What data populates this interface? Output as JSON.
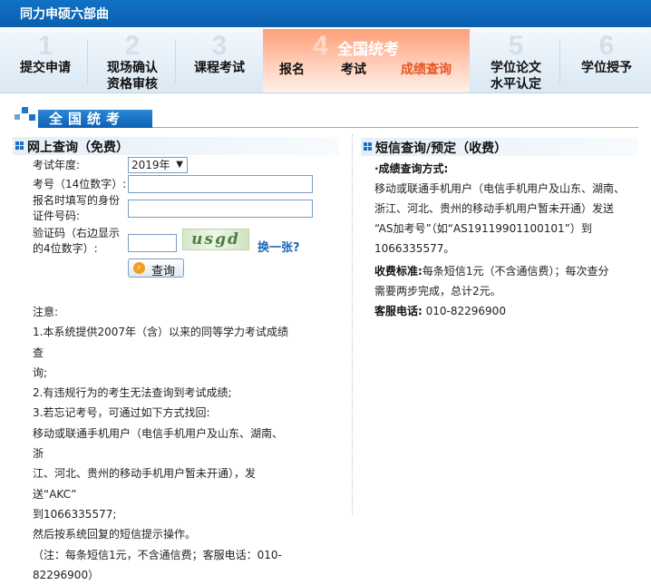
{
  "header": {
    "title": "同力申硕六部曲"
  },
  "steps": [
    {
      "num": "1",
      "label": "提交申请"
    },
    {
      "num": "2",
      "label": "现场确认\n资格审核"
    },
    {
      "num": "3",
      "label": "课程考试"
    },
    {
      "num": "4",
      "label": "全国统考",
      "subs": [
        "报名",
        "考试",
        "成绩查询"
      ],
      "active_sub": "成绩查询"
    },
    {
      "num": "5",
      "label": "学位论文\n水平认定"
    },
    {
      "num": "6",
      "label": "学位授予"
    }
  ],
  "section": {
    "title": "全国统考"
  },
  "online": {
    "heading": "网上查询（免费）",
    "year_label": "考试年度:",
    "year_value": "2019年",
    "exam_no_label": "考号（14位数字）:",
    "id_label_1": "报名时填写的身份",
    "id_label_2": "证件号码:",
    "captcha_label_1": "验证码（右边显示",
    "captcha_label_2": "的4位数字）:",
    "captcha_text": "usgd",
    "swap_label": "换一张?",
    "query_label": "查询"
  },
  "notes": [
    "注意:",
    "1.本系统提供2007年（含）以来的同等学力考试成绩查",
    "询;",
    "2.有违规行为的考生无法查询到考试成绩;",
    "3.若忘记考号，可通过如下方式找回:",
    "移动或联通手机用户（电信手机用户及山东、湖南、浙",
    "江、河北、贵州的移动手机用户暂未开通），发送“AKC”",
    "到1066335577;",
    "然后按系统回复的短信提示操作。",
    "（注：每条短信1元，不含通信费；客服电话：010-",
    "82296900）"
  ],
  "sms": {
    "heading": "短信查询/预定（收费）",
    "method_title": "·成绩查询方式:",
    "method_lines": [
      "移动或联通手机用户（电信手机用户及山东、湖南、",
      "浙江、河北、贵州的移动手机用户暂未开通）发送",
      "“AS加考号”（如“AS19119901100101”）到",
      "1066335577。"
    ],
    "fee_label": "收费标准:",
    "fee_text_1": "每条短信1元（不含通信费）；每次查分",
    "fee_text_2": "需要两步完成，总计2元。",
    "service_label": "客服电话:",
    "service_value": "010-82296900"
  }
}
